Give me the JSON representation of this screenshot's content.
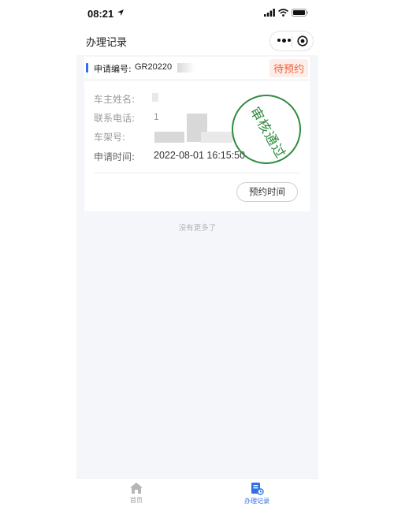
{
  "status_bar": {
    "time": "08:21"
  },
  "nav": {
    "title": "办理记录"
  },
  "record": {
    "app_no_label": "申请编号:",
    "app_no_value": "GR20220",
    "status": "待预约",
    "fields": [
      {
        "label": "车主姓名:",
        "value": ""
      },
      {
        "label": "联系电话:",
        "value": "1"
      },
      {
        "label": "车架号:",
        "value": ""
      },
      {
        "label": "申请时间:",
        "value": "2022-08-01 16:15:50"
      }
    ],
    "stamp_text": "审核通过",
    "book_button": "预约时间"
  },
  "list_end_text": "没有更多了",
  "tabbar": {
    "items": [
      {
        "label": "首页",
        "icon": "home-icon",
        "active": false
      },
      {
        "label": "办理记录",
        "icon": "records-icon",
        "active": true
      }
    ]
  },
  "colors": {
    "accent": "#2f6fe6",
    "stamp": "#2e8b3e",
    "badge_text": "#f0603a",
    "badge_bg": "#fdeee9"
  }
}
